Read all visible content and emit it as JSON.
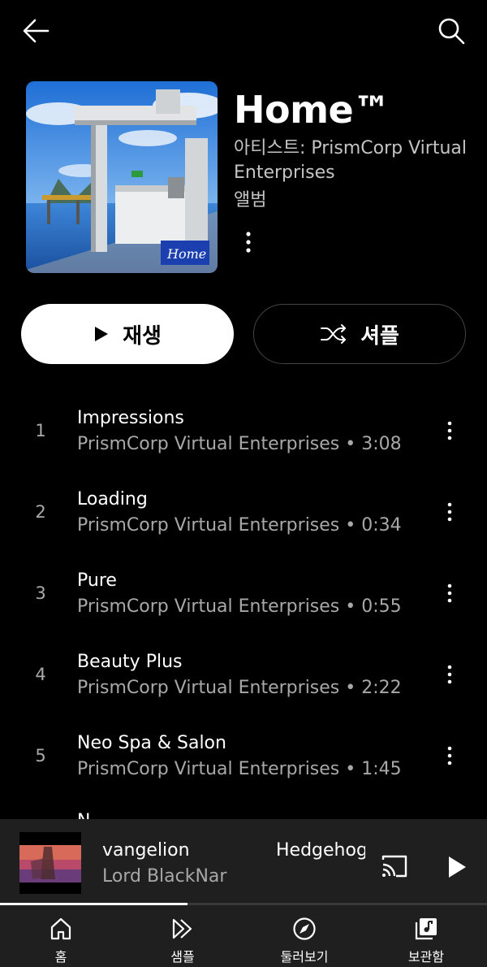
{
  "header": {
    "back_icon": "arrow-left-icon",
    "search_icon": "search-icon"
  },
  "album": {
    "title": "Home™",
    "artist_line": "아티스트: PrismCorp Virtual Enterprises",
    "type": "앨범",
    "art_logo_text": "Home"
  },
  "actions": {
    "play_label": "재생",
    "shuffle_label": "셔플"
  },
  "tracks": [
    {
      "num": "1",
      "title": "Impressions",
      "meta": "PrismCorp Virtual Enterprises • 3:08"
    },
    {
      "num": "2",
      "title": "Loading",
      "meta": "PrismCorp Virtual Enterprises • 0:34"
    },
    {
      "num": "3",
      "title": "Pure",
      "meta": "PrismCorp Virtual Enterprises • 0:55"
    },
    {
      "num": "4",
      "title": "Beauty Plus",
      "meta": "PrismCorp Virtual Enterprises • 2:22"
    },
    {
      "num": "5",
      "title": "Neo Spa & Salon",
      "meta": "PrismCorp Virtual Enterprises • 1:45"
    },
    {
      "num": "",
      "title": "N",
      "meta": ""
    }
  ],
  "mini_player": {
    "song": "vangelion",
    "next_song": "Hedgehog",
    "artist": "Lord BlackNar",
    "progress": 0.385,
    "cast_icon": "cast-icon",
    "play_icon": "play-icon"
  },
  "nav": [
    {
      "label": "홈",
      "icon": "home-icon"
    },
    {
      "label": "샘플",
      "icon": "samples-icon"
    },
    {
      "label": "둘러보기",
      "icon": "explore-icon"
    },
    {
      "label": "보관함",
      "icon": "library-icon"
    }
  ]
}
